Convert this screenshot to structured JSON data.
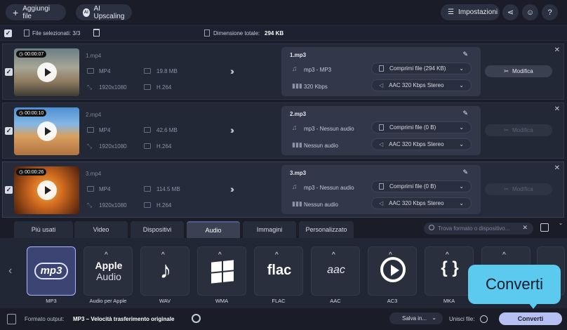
{
  "toolbar": {
    "add_files_label": "Aggiungi file",
    "ai_upscaling_label": "AI Upscaling",
    "settings_label": "Impostazioni",
    "help_label": "?"
  },
  "selection": {
    "selected_label": "File selezionati: 3/3",
    "total_size_label": "Dimensione totale:",
    "total_size_value": "294 KB"
  },
  "files": [
    {
      "duration": "00:00:07",
      "name": "1.mp4",
      "format": "MP4",
      "size": "19.8 MB",
      "resolution": "1920x1080",
      "codec": "H.264",
      "output_name": "1.mp3",
      "output_format": "mp3 - MP3",
      "bitrate": "320 Kbps",
      "compress": "Comprimi file (294 KB)",
      "audio": "AAC 320 Kbps Stereo",
      "modify": "Modifica",
      "modify_enabled": true
    },
    {
      "duration": "00:00:10",
      "name": "2.mp4",
      "format": "MP4",
      "size": "42.6 MB",
      "resolution": "1920x1080",
      "codec": "H.264",
      "output_name": "2.mp3",
      "output_format": "mp3 - Nessun audio",
      "bitrate": "Nessun audio",
      "compress": "Comprimi file (0 B)",
      "audio": "AAC 320 Kbps Stereo",
      "modify": "Modifica",
      "modify_enabled": false
    },
    {
      "duration": "00:00:26",
      "name": "3.mp4",
      "format": "MP4",
      "size": "114.5 MB",
      "resolution": "1920x1080",
      "codec": "H.264",
      "output_name": "3.mp3",
      "output_format": "mp3 - Nessun audio",
      "bitrate": "Nessun audio",
      "compress": "Comprimi file (0 B)",
      "audio": "AAC 320 Kbps Stereo",
      "modify": "Modifica",
      "modify_enabled": false
    }
  ],
  "tabs": [
    "Più usati",
    "Video",
    "Dispositivi",
    "Audio",
    "Immagini",
    "Personalizzato"
  ],
  "active_tab": "Audio",
  "search_placeholder": "Trova formato o dispositivo...",
  "formats": [
    {
      "label": "MP3",
      "icon": "mp3-logo",
      "active": true
    },
    {
      "label": "Audio per Apple",
      "icon": "apple-audio-logo",
      "text1": "Apple",
      "text2": "Audio"
    },
    {
      "label": "WAV",
      "icon": "music-note-icon"
    },
    {
      "label": "WMA",
      "icon": "windows-logo"
    },
    {
      "label": "FLAC",
      "icon": "flac-logo",
      "text1": "flac"
    },
    {
      "label": "AAC",
      "icon": "aac-logo",
      "text1": "aac"
    },
    {
      "label": "AC3",
      "icon": "ac3-logo"
    },
    {
      "label": "MKA",
      "icon": "mka-logo"
    }
  ],
  "bottom": {
    "output_format_label": "Formato output:",
    "output_format_value": "MP3 – Velocità trasferimento originale",
    "save_label": "Salva in...",
    "merge_label": "Unisci file:",
    "convert_label": "Converti"
  },
  "callout": {
    "text": "Converti"
  },
  "colors": {
    "accent": "#5cc9ee",
    "convert_button": "#b7c0f2",
    "active_tile": "#3b4472"
  }
}
